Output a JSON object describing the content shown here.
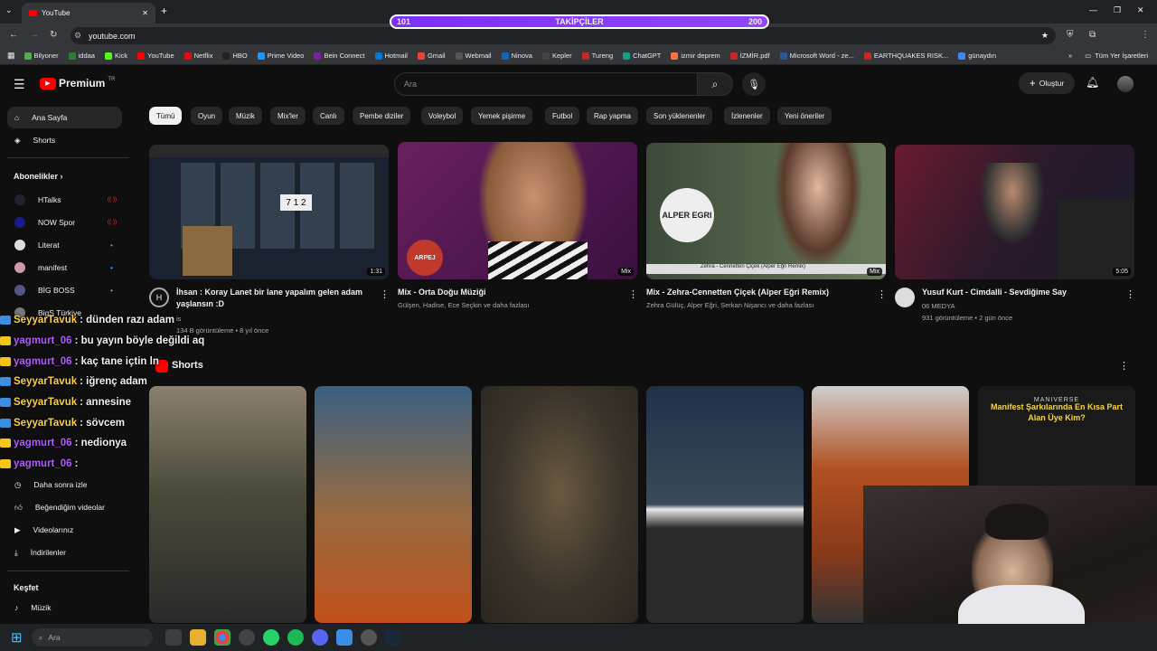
{
  "browser": {
    "tab_title": "YouTube",
    "url": "youtube.com",
    "bookmarks": [
      "Bilyoner",
      "iddaa",
      "Kick",
      "YouTube",
      "Netflix",
      "HBO",
      "Prime Video",
      "Bein Connect",
      "Hotmail",
      "Gmail",
      "Webmail",
      "Ninova",
      "Kepler",
      "Tureng",
      "ChatGPT",
      "izmir deprem",
      "İZMİR.pdf",
      "Microsoft Word - ze...",
      "EARTHQUAKES RISK...",
      "günaydın"
    ],
    "all_bookmarks": "Tüm Yer İşaretleri",
    "profile_initial": "G"
  },
  "follow_goal": {
    "label": "TAKİPÇİLER",
    "current": "101",
    "target": "200",
    "progress": 0.01
  },
  "yt": {
    "logo": "Premium",
    "logo_region": "TR",
    "search_placeholder": "Ara",
    "create_label": "Oluştur",
    "sidebar": {
      "home": "Ana Sayfa",
      "shorts": "Shorts",
      "subs_header": "Abonelikler",
      "subs": [
        "HTalks",
        "NOW Spor",
        "Literat",
        "manifest",
        "BİG BOSS",
        "BigS Türkiye"
      ],
      "later": "Daha sonra izle",
      "liked": "Beğendiğim videolar",
      "your_videos": "Videolarınız",
      "downloads": "İndirilenler",
      "explore": "Keşfet",
      "music": "Müzik"
    },
    "chips": [
      "Tümü",
      "Oyun",
      "Müzik",
      "Mix'ler",
      "Canlı",
      "Pembe diziler",
      "Voleybol",
      "Yemek pişirme",
      "Futbol",
      "Rap yapma",
      "Son yüklenenler",
      "İzlenenler",
      "Yeni öneriler"
    ],
    "videos": [
      {
        "title": "İhsan : Koray Lanet bir lane yapalım gelen adam yaşlansın :D",
        "channel": "is",
        "meta": "134 B görüntüleme • 8 yıl önce",
        "duration": "1:31"
      },
      {
        "title": "Mix - Orta Doğu Müziği",
        "channel": "Gülşen, Hadise, Ece Seçkin ve daha fazlası",
        "meta": "",
        "duration": "Mix"
      },
      {
        "title": "Mix - Zehra-Cennetten Çiçek (Alper Eğri Remix)",
        "channel": "Zehra Gülüç, Alper Eğri, Serkan Nişancı ve daha fazlası",
        "meta": "",
        "duration": "Mix"
      },
      {
        "title": "Yusuf Kurt - Cimdalli - Sevdiğime Say",
        "channel": "06 MEDYA",
        "meta": "931 görüntüleme • 2 gün önce",
        "duration": "5:05"
      }
    ],
    "thumb_text": {
      "v2": "ARPEJ",
      "v3": "ALPER EGRI",
      "v3_caption": "Zehra - Cennetten Çiçek (Alper Eğri Remix)"
    },
    "shorts_header": "Shorts",
    "short6": {
      "brand": "MANIVERSE",
      "headline": "Manifest Şarkılarında En Kısa Part Alan Üye Kim?"
    }
  },
  "chat": [
    {
      "user": "SeyyarTavuk",
      "msg": ": dünden razı adam",
      "color": "#ffd23c",
      "badge": "#3a8ee6"
    },
    {
      "user": "yagmurt_06",
      "msg": ": bu yayın böyle değildi aq",
      "color": "#b35cff",
      "badge": "#f5c518"
    },
    {
      "user": "yagmurt_06",
      "msg": ": kaç tane içtin ln",
      "color": "#b35cff",
      "badge": "#f5c518"
    },
    {
      "user": "SeyyarTavuk",
      "msg": ": iğrenç adam",
      "color": "#ffd23c",
      "badge": "#3a8ee6"
    },
    {
      "user": "SeyyarTavuk",
      "msg": ": annesine",
      "color": "#ffd23c",
      "badge": "#3a8ee6"
    },
    {
      "user": "SeyyarTavuk",
      "msg": ": sövcem",
      "color": "#ffd23c",
      "badge": "#3a8ee6"
    },
    {
      "user": "yagmurt_06",
      "msg": ": nedionya",
      "color": "#b35cff",
      "badge": "#f5c518"
    },
    {
      "user": "yagmurt_06",
      "msg": ":",
      "color": "#b35cff",
      "badge": "#f5c518"
    }
  ],
  "taskbar": {
    "search_placeholder": "Ara"
  },
  "colors": {
    "bg": "#0f0f0f",
    "accent_red": "#ff0000",
    "chip_active": "#f1f1f1"
  }
}
